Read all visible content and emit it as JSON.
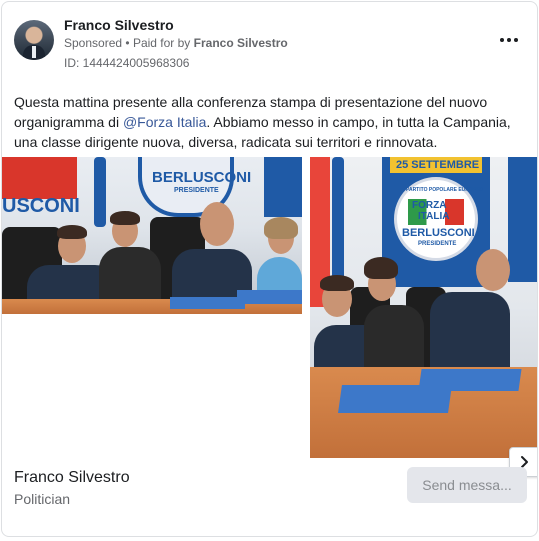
{
  "post": {
    "author": "Franco Silvestro",
    "sponsored_label": "Sponsored",
    "separator": "•",
    "paid_for_prefix": "Paid for by",
    "paid_for_name": "Franco Silvestro",
    "id_line": "ID: 1444424005968306",
    "text_before": "Questa mattina presente alla conferenza stampa di presentazione del nuovo organigramma di ",
    "mention": "@Forza Italia",
    "text_after": ". Abbiamo messo in campo, in tutta la Campania, una classe dirigente nuova, diversa, radicata sui territori e rinnovata."
  },
  "media": {
    "image1_banner_text": "BERLUSCONI",
    "image1_banner_sub": "PRESIDENTE",
    "image1_left_text": "USCONI",
    "image2_banner_date": "25 SETTEMBRE",
    "image2_banner_party_top": "FORZA",
    "image2_banner_party_bottom": "ITALIA",
    "image2_banner_text": "BERLUSCONI",
    "image2_banner_sub": "PRESIDENTE",
    "image2_banner_arc": "PARTITO POPOLARE EUROPEO",
    "next_icon": "chevron-right-icon"
  },
  "footer": {
    "page_name": "Franco Silvestro",
    "page_category": "Politician",
    "send_button": "Send messa..."
  },
  "colors": {
    "link": "#385898",
    "muted": "#65676b",
    "forza_blue": "#1f5aa6",
    "forza_red": "#d9362b"
  }
}
